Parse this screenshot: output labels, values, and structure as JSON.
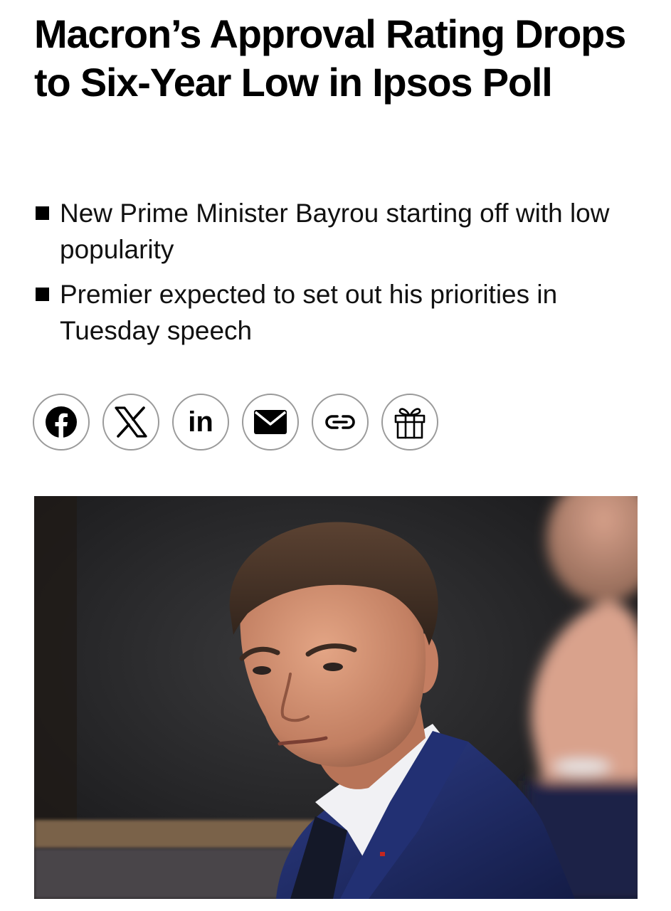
{
  "article": {
    "headline": "Macron’s Approval Rating Drops to Six-Year Low in Ipsos Poll",
    "bullets": [
      "New Prime Minister Bayrou starting off with low popularity",
      "Premier expected to set out his priorities in Tuesday speech"
    ]
  },
  "share": {
    "buttons": [
      {
        "icon": "facebook-icon"
      },
      {
        "icon": "x-icon"
      },
      {
        "icon": "linkedin-icon",
        "text": "in"
      },
      {
        "icon": "email-icon"
      },
      {
        "icon": "link-icon"
      },
      {
        "icon": "gift-icon"
      }
    ]
  },
  "colors": {
    "text": "#000000",
    "button_border": "#9a9a9a",
    "suit": "#1f2d6b"
  }
}
